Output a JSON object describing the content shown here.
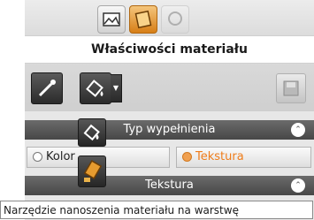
{
  "panel": {
    "title": "Właściwości materiału",
    "top_icons": [
      "image-icon",
      "material-icon",
      "render-icon"
    ]
  },
  "toolbar": {
    "buttons": [
      "eyedropper-icon",
      "paint-bucket-icon",
      "save-icon"
    ]
  },
  "fill_type": {
    "label": "Typ wypełnienia",
    "options": [
      {
        "label": "Kolor",
        "selected": false
      },
      {
        "label": "Tekstura",
        "selected": true
      }
    ]
  },
  "texture_section": {
    "label": "Tekstura"
  },
  "tooltip": {
    "text": "Narzędzie nanoszenia materiału na warstwę"
  },
  "colors": {
    "accent": "#ef7d1b",
    "section_bg": "#555555"
  }
}
